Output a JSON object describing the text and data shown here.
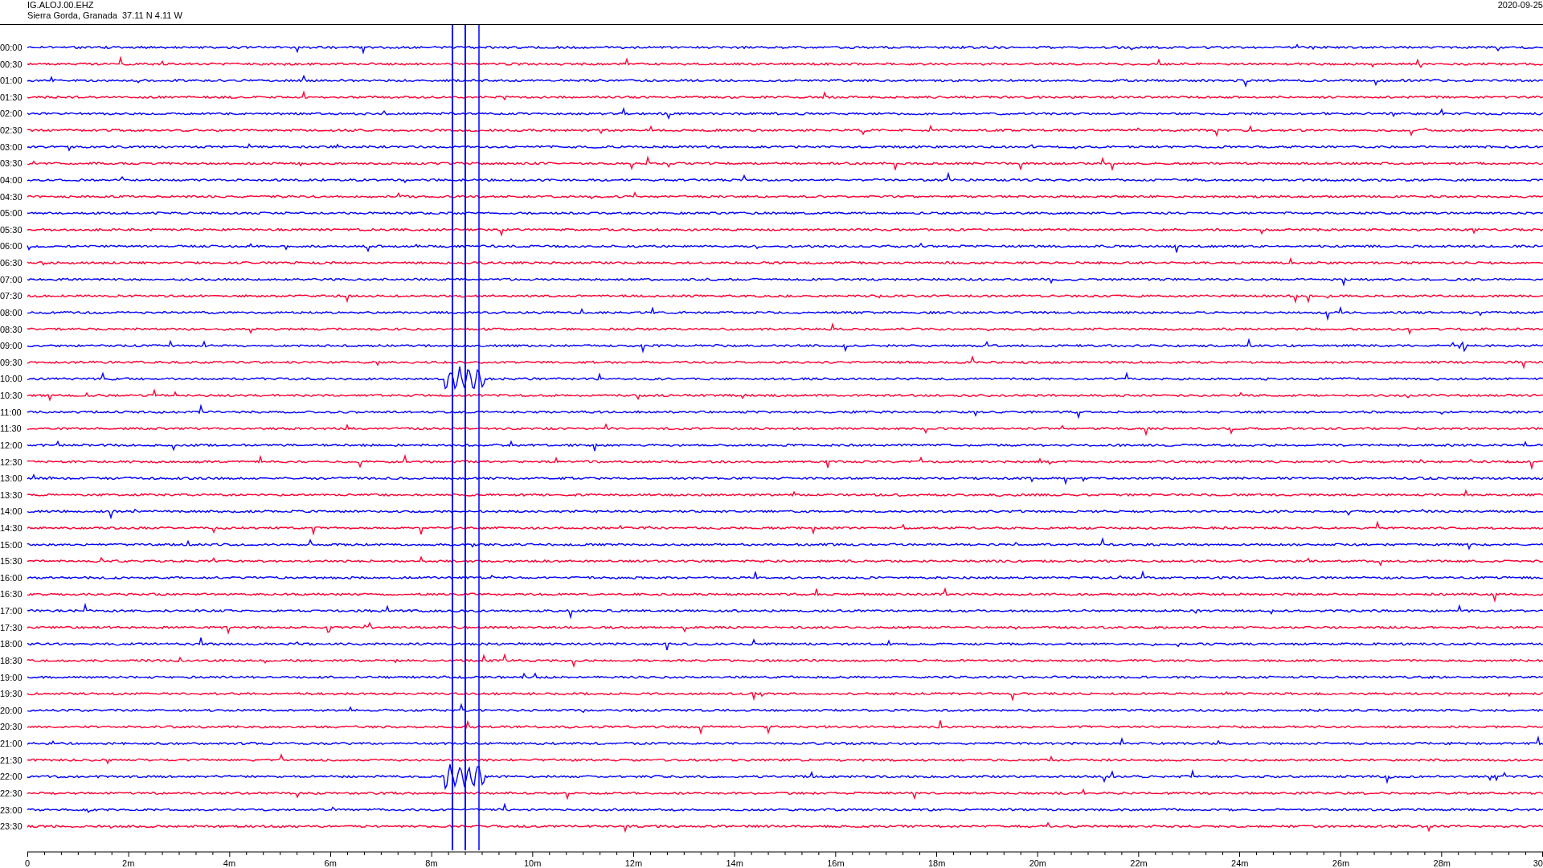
{
  "header": {
    "station": "IG.ALOJ.00.EHZ",
    "location": "Sierra Gorda, Granada  37.11 N 4.11 W",
    "date": "2020-09-25"
  },
  "helicorder": {
    "rows": [
      {
        "time": "00:00",
        "color": "#0000ff"
      },
      {
        "time": "00:30",
        "color": "#ff0033"
      },
      {
        "time": "01:00",
        "color": "#0000ff"
      },
      {
        "time": "01:30",
        "color": "#ff0033"
      },
      {
        "time": "02:00",
        "color": "#0000ff"
      },
      {
        "time": "02:30",
        "color": "#ff0033"
      },
      {
        "time": "03:00",
        "color": "#0000ff"
      },
      {
        "time": "03:30",
        "color": "#ff0033"
      },
      {
        "time": "04:00",
        "color": "#0000ff"
      },
      {
        "time": "04:30",
        "color": "#ff0033"
      },
      {
        "time": "05:00",
        "color": "#0000ff"
      },
      {
        "time": "05:30",
        "color": "#ff0033"
      },
      {
        "time": "06:00",
        "color": "#0000ff"
      },
      {
        "time": "06:30",
        "color": "#ff0033"
      },
      {
        "time": "07:00",
        "color": "#0000ff"
      },
      {
        "time": "07:30",
        "color": "#ff0033"
      },
      {
        "time": "08:00",
        "color": "#0000ff"
      },
      {
        "time": "08:30",
        "color": "#ff0033"
      },
      {
        "time": "09:00",
        "color": "#0000ff"
      },
      {
        "time": "09:30",
        "color": "#ff0033"
      },
      {
        "time": "10:00",
        "color": "#0000ff"
      },
      {
        "time": "10:30",
        "color": "#ff0033"
      },
      {
        "time": "11:00",
        "color": "#0000ff"
      },
      {
        "time": "11:30",
        "color": "#ff0033"
      },
      {
        "time": "12:00",
        "color": "#0000ff"
      },
      {
        "time": "12:30",
        "color": "#ff0033"
      },
      {
        "time": "13:00",
        "color": "#0000ff"
      },
      {
        "time": "13:30",
        "color": "#ff0033"
      },
      {
        "time": "14:00",
        "color": "#0000ff"
      },
      {
        "time": "14:30",
        "color": "#ff0033"
      },
      {
        "time": "15:00",
        "color": "#0000ff"
      },
      {
        "time": "15:30",
        "color": "#ff0033"
      },
      {
        "time": "16:00",
        "color": "#0000ff"
      },
      {
        "time": "16:30",
        "color": "#ff0033"
      },
      {
        "time": "17:00",
        "color": "#0000ff"
      },
      {
        "time": "17:30",
        "color": "#ff0033"
      },
      {
        "time": "18:00",
        "color": "#0000ff"
      },
      {
        "time": "18:30",
        "color": "#ff0033"
      },
      {
        "time": "19:00",
        "color": "#0000ff"
      },
      {
        "time": "19:30",
        "color": "#ff0033"
      },
      {
        "time": "20:00",
        "color": "#0000ff"
      },
      {
        "time": "20:30",
        "color": "#ff0033"
      },
      {
        "time": "21:00",
        "color": "#0000ff"
      },
      {
        "time": "21:30",
        "color": "#ff0033"
      },
      {
        "time": "22:00",
        "color": "#0000ff"
      },
      {
        "time": "22:30",
        "color": "#ff0033"
      },
      {
        "time": "23:00",
        "color": "#0000ff"
      },
      {
        "time": "23:30",
        "color": "#ff0033"
      }
    ],
    "x_ticks": [
      "0",
      "2m",
      "4m",
      "6m",
      "8m",
      "10m",
      "12m",
      "14m",
      "16m",
      "18m",
      "20m",
      "22m",
      "24m",
      "26m",
      "28m",
      "30"
    ]
  }
}
